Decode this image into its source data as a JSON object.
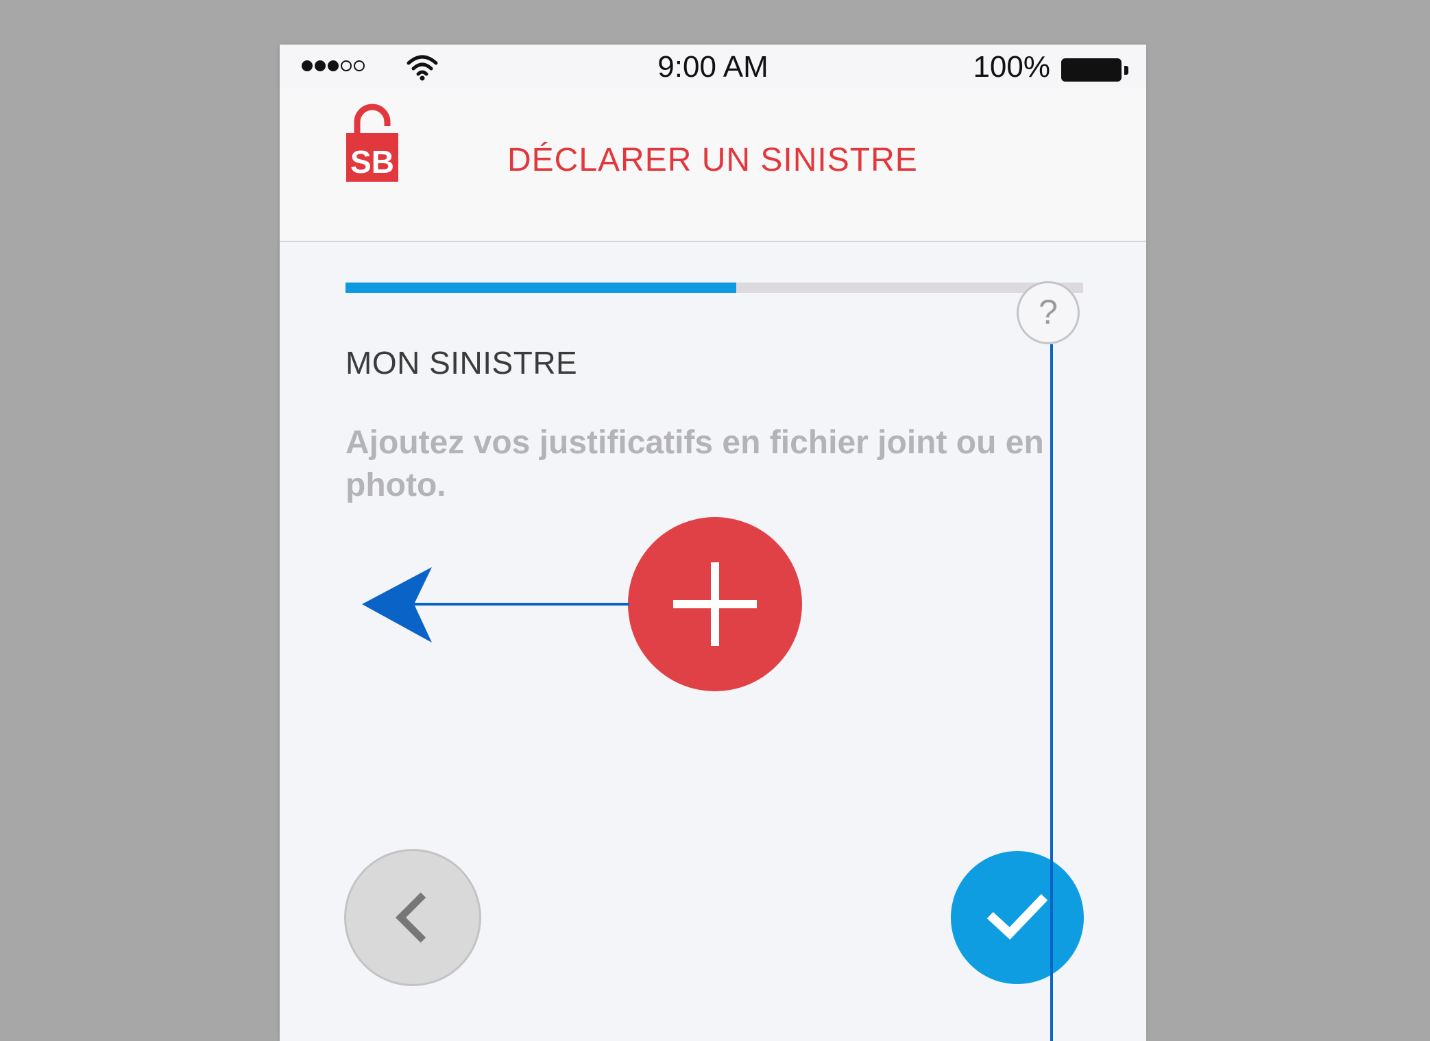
{
  "status_bar": {
    "time": "9:00 AM",
    "battery": "100%",
    "signal_bars_filled": 3,
    "signal_bars_total": 5
  },
  "header": {
    "logo_text": "SB",
    "title": "DÉCLARER UN SINISTRE"
  },
  "progress": {
    "fraction": 0.53
  },
  "section": {
    "title": "MON SINISTRE",
    "help_label": "?"
  },
  "instruction": "Ajoutez vos justificatifs en fichier joint ou en photo.",
  "icons": {
    "add": "plus-icon",
    "back": "chevron-left-icon",
    "confirm": "checkmark-icon",
    "help": "question-mark-icon"
  },
  "colors": {
    "brand_red": "#e04146",
    "accent_blue": "#0d9de0",
    "annotation_blue": "#0a63c6"
  }
}
